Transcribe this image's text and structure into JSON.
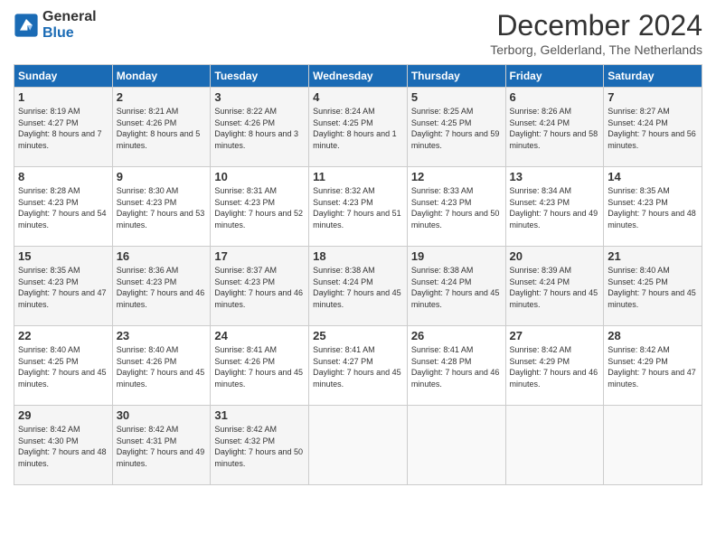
{
  "logo": {
    "general": "General",
    "blue": "Blue"
  },
  "title": "December 2024",
  "location": "Terborg, Gelderland, The Netherlands",
  "weekdays": [
    "Sunday",
    "Monday",
    "Tuesday",
    "Wednesday",
    "Thursday",
    "Friday",
    "Saturday"
  ],
  "weeks": [
    [
      {
        "day": "1",
        "sunrise": "8:19 AM",
        "sunset": "4:27 PM",
        "daylight": "8 hours and 7 minutes."
      },
      {
        "day": "2",
        "sunrise": "8:21 AM",
        "sunset": "4:26 PM",
        "daylight": "8 hours and 5 minutes."
      },
      {
        "day": "3",
        "sunrise": "8:22 AM",
        "sunset": "4:26 PM",
        "daylight": "8 hours and 3 minutes."
      },
      {
        "day": "4",
        "sunrise": "8:24 AM",
        "sunset": "4:25 PM",
        "daylight": "8 hours and 1 minute."
      },
      {
        "day": "5",
        "sunrise": "8:25 AM",
        "sunset": "4:25 PM",
        "daylight": "7 hours and 59 minutes."
      },
      {
        "day": "6",
        "sunrise": "8:26 AM",
        "sunset": "4:24 PM",
        "daylight": "7 hours and 58 minutes."
      },
      {
        "day": "7",
        "sunrise": "8:27 AM",
        "sunset": "4:24 PM",
        "daylight": "7 hours and 56 minutes."
      }
    ],
    [
      {
        "day": "8",
        "sunrise": "8:28 AM",
        "sunset": "4:23 PM",
        "daylight": "7 hours and 54 minutes."
      },
      {
        "day": "9",
        "sunrise": "8:30 AM",
        "sunset": "4:23 PM",
        "daylight": "7 hours and 53 minutes."
      },
      {
        "day": "10",
        "sunrise": "8:31 AM",
        "sunset": "4:23 PM",
        "daylight": "7 hours and 52 minutes."
      },
      {
        "day": "11",
        "sunrise": "8:32 AM",
        "sunset": "4:23 PM",
        "daylight": "7 hours and 51 minutes."
      },
      {
        "day": "12",
        "sunrise": "8:33 AM",
        "sunset": "4:23 PM",
        "daylight": "7 hours and 50 minutes."
      },
      {
        "day": "13",
        "sunrise": "8:34 AM",
        "sunset": "4:23 PM",
        "daylight": "7 hours and 49 minutes."
      },
      {
        "day": "14",
        "sunrise": "8:35 AM",
        "sunset": "4:23 PM",
        "daylight": "7 hours and 48 minutes."
      }
    ],
    [
      {
        "day": "15",
        "sunrise": "8:35 AM",
        "sunset": "4:23 PM",
        "daylight": "7 hours and 47 minutes."
      },
      {
        "day": "16",
        "sunrise": "8:36 AM",
        "sunset": "4:23 PM",
        "daylight": "7 hours and 46 minutes."
      },
      {
        "day": "17",
        "sunrise": "8:37 AM",
        "sunset": "4:23 PM",
        "daylight": "7 hours and 46 minutes."
      },
      {
        "day": "18",
        "sunrise": "8:38 AM",
        "sunset": "4:24 PM",
        "daylight": "7 hours and 45 minutes."
      },
      {
        "day": "19",
        "sunrise": "8:38 AM",
        "sunset": "4:24 PM",
        "daylight": "7 hours and 45 minutes."
      },
      {
        "day": "20",
        "sunrise": "8:39 AM",
        "sunset": "4:24 PM",
        "daylight": "7 hours and 45 minutes."
      },
      {
        "day": "21",
        "sunrise": "8:40 AM",
        "sunset": "4:25 PM",
        "daylight": "7 hours and 45 minutes."
      }
    ],
    [
      {
        "day": "22",
        "sunrise": "8:40 AM",
        "sunset": "4:25 PM",
        "daylight": "7 hours and 45 minutes."
      },
      {
        "day": "23",
        "sunrise": "8:40 AM",
        "sunset": "4:26 PM",
        "daylight": "7 hours and 45 minutes."
      },
      {
        "day": "24",
        "sunrise": "8:41 AM",
        "sunset": "4:26 PM",
        "daylight": "7 hours and 45 minutes."
      },
      {
        "day": "25",
        "sunrise": "8:41 AM",
        "sunset": "4:27 PM",
        "daylight": "7 hours and 45 minutes."
      },
      {
        "day": "26",
        "sunrise": "8:41 AM",
        "sunset": "4:28 PM",
        "daylight": "7 hours and 46 minutes."
      },
      {
        "day": "27",
        "sunrise": "8:42 AM",
        "sunset": "4:29 PM",
        "daylight": "7 hours and 46 minutes."
      },
      {
        "day": "28",
        "sunrise": "8:42 AM",
        "sunset": "4:29 PM",
        "daylight": "7 hours and 47 minutes."
      }
    ],
    [
      {
        "day": "29",
        "sunrise": "8:42 AM",
        "sunset": "4:30 PM",
        "daylight": "7 hours and 48 minutes."
      },
      {
        "day": "30",
        "sunrise": "8:42 AM",
        "sunset": "4:31 PM",
        "daylight": "7 hours and 49 minutes."
      },
      {
        "day": "31",
        "sunrise": "8:42 AM",
        "sunset": "4:32 PM",
        "daylight": "7 hours and 50 minutes."
      },
      null,
      null,
      null,
      null
    ]
  ]
}
